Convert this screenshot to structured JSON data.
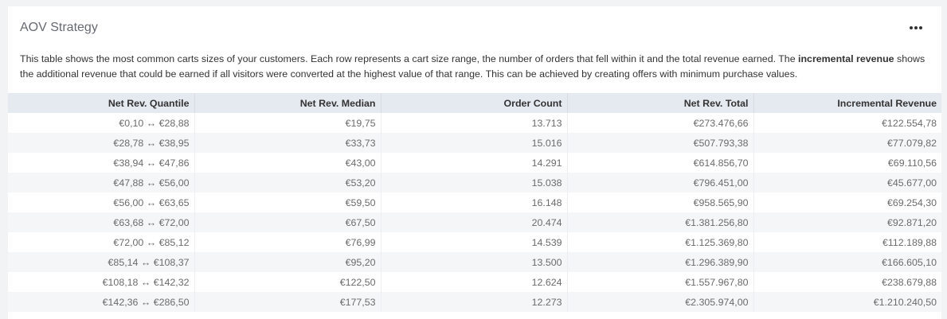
{
  "card": {
    "title": "AOV Strategy",
    "description_part1": "This table shows the most common carts sizes of your customers. Each row represents a cart size range, the number of orders that fell within it and the total revenue earned. The ",
    "description_bold": "incremental revenue",
    "description_part2": " shows the additional revenue that could be earned if all visitors were converted at the highest value of that range. This can be achieved by creating offers with minimum purchase values."
  },
  "table": {
    "headers": [
      "Net Rev. Quantile",
      "Net Rev. Median",
      "Order Count",
      "Net Rev. Total",
      "Incremental Revenue"
    ],
    "rows": [
      [
        "€0,10 ↔ €28,88",
        "€19,75",
        "13.713",
        "€273.476,66",
        "€122.554,78"
      ],
      [
        "€28,78 ↔ €38,95",
        "€33,73",
        "15.016",
        "€507.793,38",
        "€77.079,82"
      ],
      [
        "€38,94 ↔ €47,86",
        "€43,00",
        "14.291",
        "€614.856,70",
        "€69.110,56"
      ],
      [
        "€47,88 ↔ €56,00",
        "€53,20",
        "15.038",
        "€796.451,00",
        "€45.677,00"
      ],
      [
        "€56,00 ↔ €63,65",
        "€59,50",
        "16.148",
        "€958.565,90",
        "€69.254,30"
      ],
      [
        "€63,68 ↔ €72,00",
        "€67,50",
        "20.474",
        "€1.381.256,80",
        "€92.871,20"
      ],
      [
        "€72,00 ↔ €85,12",
        "€76,99",
        "14.539",
        "€1.125.369,80",
        "€112.189,88"
      ],
      [
        "€85,14 ↔ €108,37",
        "€95,20",
        "13.500",
        "€1.296.389,90",
        "€166.605,10"
      ],
      [
        "€108,18 ↔ €142,32",
        "€122,50",
        "12.624",
        "€1.557.967,80",
        "€238.679,88"
      ],
      [
        "€142,36 ↔ €286,50",
        "€177,53",
        "12.273",
        "€2.305.974,00",
        "€1.210.240,50"
      ]
    ]
  }
}
